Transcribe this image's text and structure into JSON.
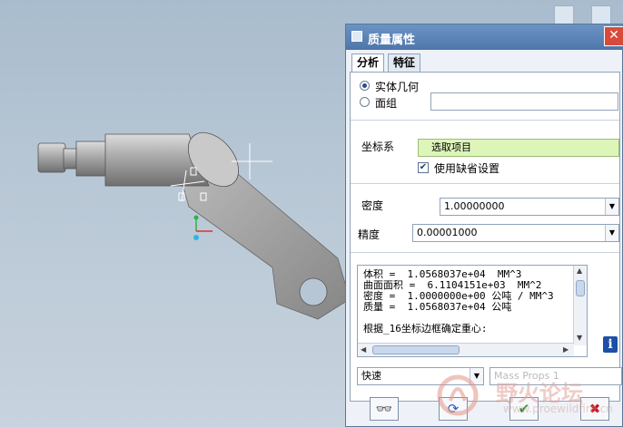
{
  "dialog": {
    "title": "质量属性",
    "close_label": "✕"
  },
  "tabs": [
    {
      "label": "分析",
      "active": true
    },
    {
      "label": "特征",
      "active": false
    }
  ],
  "geometry": {
    "options": [
      {
        "label": "实体几何",
        "selected": true
      },
      {
        "label": "面组",
        "selected": false
      }
    ],
    "surface_value": ""
  },
  "coord": {
    "label": "坐标系",
    "field_value": "选取项目",
    "use_default_label": "使用缺省设置",
    "use_default_checked": true
  },
  "density": {
    "label": "密度",
    "value": "1.00000000"
  },
  "precision": {
    "label": "精度",
    "value": "0.00001000"
  },
  "results": {
    "lines": [
      "体积 =  1.0568037e+04  MM^3",
      "曲面面积 =  6.1104151e+03  MM^2",
      "密度 =  1.0000000e+00 公吨 / MM^3",
      "质量 =  1.0568037e+04 公吨",
      "",
      "根据_16坐标边框确定重心:"
    ]
  },
  "footer": {
    "mode_value": "快速",
    "name_value": "Mass Props 1"
  },
  "watermark": {
    "text": "野火论坛",
    "url": "www.proewildfire.cn"
  },
  "colors": {
    "title_bar": "#5a82b8",
    "selector_field": "#ddf5b9",
    "ok": "#2e8b2e",
    "cancel": "#c8161d"
  }
}
